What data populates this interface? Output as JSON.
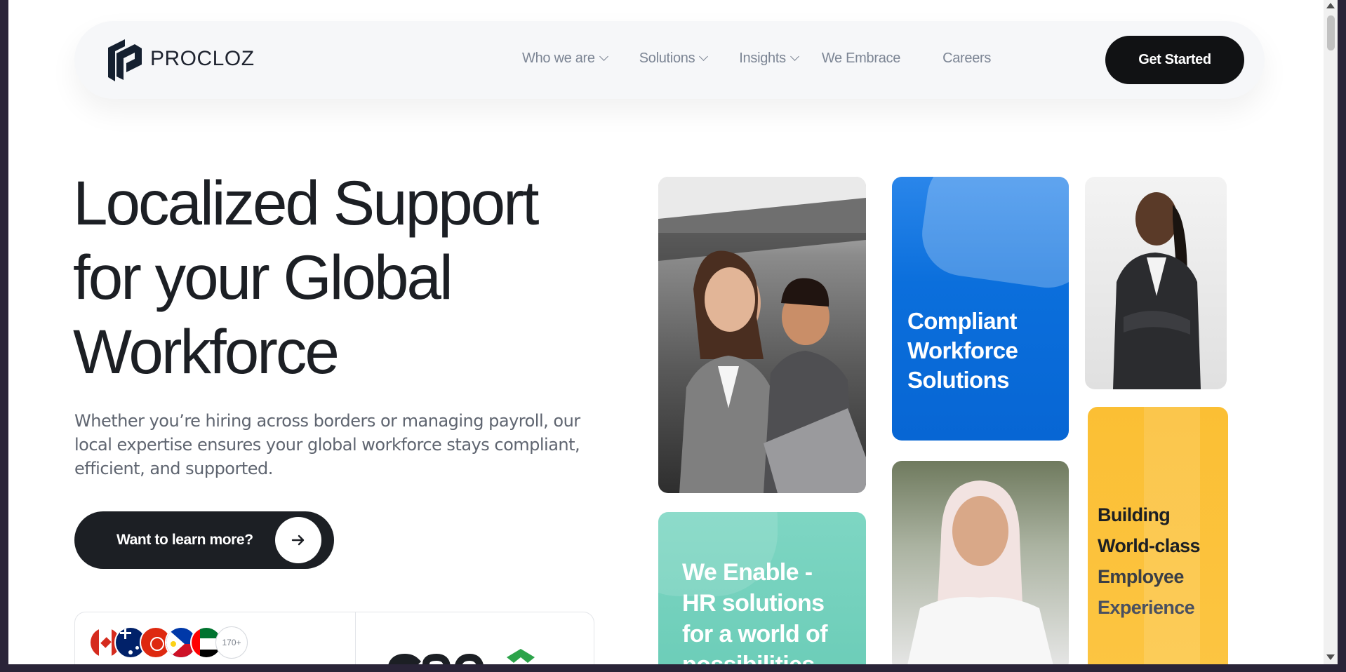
{
  "brand": {
    "name": "PROCLOZ"
  },
  "nav": {
    "items": [
      {
        "label": "Who we are",
        "has_dropdown": true
      },
      {
        "label": "Solutions",
        "has_dropdown": true
      },
      {
        "label": "Insights",
        "has_dropdown": true
      },
      {
        "label": "We Embrace",
        "has_dropdown": false
      },
      {
        "label": "Careers",
        "has_dropdown": false
      }
    ],
    "cta_label": "Get Started"
  },
  "hero": {
    "title_line1": "Localized Support",
    "title_line2": "for your Global",
    "title_line3": "Workforce",
    "subtitle": "Whether you’re hiring across borders or managing payroll, our local expertise ensures your global workforce stays compliant, efficient, and supported.",
    "learn_more_label": "Want to learn more?"
  },
  "badges": {
    "country_count": "170+",
    "flags": [
      "canada-flag-icon",
      "australia-flag-icon",
      "hong-kong-flag-icon",
      "philippines-flag-icon",
      "uae-flag-icon"
    ]
  },
  "tiles": {
    "compliant": {
      "line1": "Compliant",
      "line2": "Workforce",
      "line3": "Solutions"
    },
    "enable": {
      "line1": "We Enable -",
      "line2": "HR solutions",
      "line3": "for a world of",
      "line4": "possibilities"
    },
    "building": {
      "line1": "Building",
      "line2": "World-class",
      "line3": "Employee",
      "line4": "Experience"
    }
  },
  "colors": {
    "primary_dark": "#111214",
    "nav_text": "#7c8594",
    "tile_blue": "#0b6fdc",
    "tile_teal": "#6ccdb8",
    "tile_yellow": "#fbc23c"
  }
}
